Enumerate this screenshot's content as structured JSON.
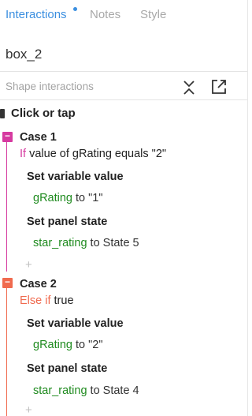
{
  "tabs": [
    {
      "label": "Interactions",
      "active": true,
      "has_dot": true
    },
    {
      "label": "Notes",
      "active": false
    },
    {
      "label": "Style",
      "active": false
    }
  ],
  "widget_name": "box_2",
  "section": {
    "title": "Shape interactions",
    "icons": [
      "collapse-icon",
      "open-external-icon"
    ]
  },
  "event": {
    "label": "Click or tap"
  },
  "cases": [
    {
      "name": "Case 1",
      "condition_keyword": "If",
      "condition_text": "value of gRating equals \"2\"",
      "color": "#d63aa0",
      "actions": [
        {
          "title": "Set variable value",
          "target": "gRating",
          "connector": " to ",
          "value": "\"1\""
        },
        {
          "title": "Set panel state",
          "target": "star_rating",
          "connector": " to ",
          "value": "State 5"
        }
      ]
    },
    {
      "name": "Case 2",
      "condition_keyword": "Else if",
      "condition_text": "true",
      "color": "#f06a4e",
      "actions": [
        {
          "title": "Set variable value",
          "target": "gRating",
          "connector": " to ",
          "value": "\"2\""
        },
        {
          "title": "Set panel state",
          "target": "star_rating",
          "connector": " to ",
          "value": "State 4"
        }
      ]
    }
  ],
  "add_symbol": "+",
  "case_badge_symbol": "−",
  "colors": {
    "accent": "#3b8fe0",
    "inactive_tab": "#a8a8a8",
    "variable_green": "#1e8a1e",
    "condition_if": "#d63aa0",
    "condition_else_if": "#f06a4e"
  }
}
